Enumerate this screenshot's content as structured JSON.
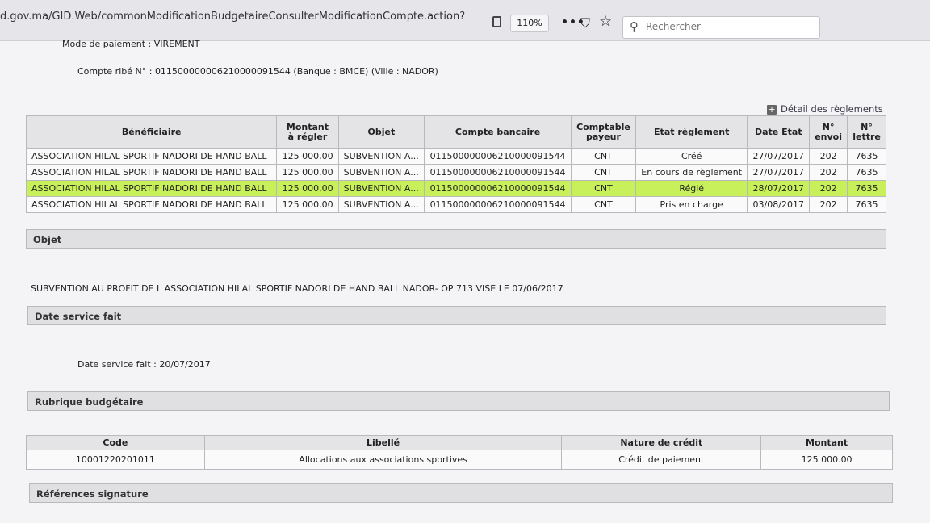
{
  "browser": {
    "url": "d.gov.ma/GID.Web/commonModificationBudgetaireConsulterModificationCompte.action?",
    "zoom": "110%",
    "search_placeholder": "Rechercher"
  },
  "header": {
    "mode_paiement": "Mode de paiement : VIREMENT",
    "compte": "Compte ribé N° : 011500000006210000091544 (Banque : BMCE) (Ville : NADOR)",
    "detail_link": "Détail des règlements"
  },
  "reglements": {
    "columns": [
      "Bénéficiaire",
      "Montant à régler",
      "Objet",
      "Compte bancaire",
      "Comptable payeur",
      "Etat règlement",
      "Date Etat",
      "N° envoi",
      "N° lettre"
    ],
    "rows": [
      [
        "ASSOCIATION HILAL SPORTIF NADORI DE HAND BALL",
        "125 000,00",
        "SUBVENTION A...",
        "011500000006210000091544",
        "CNT",
        "Créé",
        "27/07/2017",
        "202",
        "7635"
      ],
      [
        "ASSOCIATION HILAL SPORTIF NADORI DE HAND BALL",
        "125 000,00",
        "SUBVENTION A...",
        "011500000006210000091544",
        "CNT",
        "En cours de règlement",
        "27/07/2017",
        "202",
        "7635"
      ],
      [
        "ASSOCIATION HILAL SPORTIF NADORI DE HAND BALL",
        "125 000,00",
        "SUBVENTION A...",
        "011500000006210000091544",
        "CNT",
        "Réglé",
        "28/07/2017",
        "202",
        "7635"
      ],
      [
        "ASSOCIATION HILAL SPORTIF NADORI DE HAND BALL",
        "125 000,00",
        "SUBVENTION A...",
        "011500000006210000091544",
        "CNT",
        "Pris en charge",
        "03/08/2017",
        "202",
        "7635"
      ]
    ]
  },
  "sections": {
    "objet_title": "Objet",
    "objet_text": "SUBVENTION AU PROFIT DE L ASSOCIATION HILAL SPORTIF NADORI DE HAND BALL NADOR- OP 713 VISE LE 07/06/2017",
    "date_service_title": "Date service fait",
    "date_service_text": "Date service fait : 20/07/2017",
    "rubrique_title": "Rubrique budgétaire",
    "references_title": "Références signature"
  },
  "rubrique": {
    "columns": [
      "Code",
      "Libellé",
      "Nature de crédit",
      "Montant"
    ],
    "row": [
      "10001220201011",
      "Allocations aux associations sportives",
      "Crédit de paiement",
      "125 000.00"
    ]
  },
  "colors": {
    "highlight": "#c8f05a"
  }
}
